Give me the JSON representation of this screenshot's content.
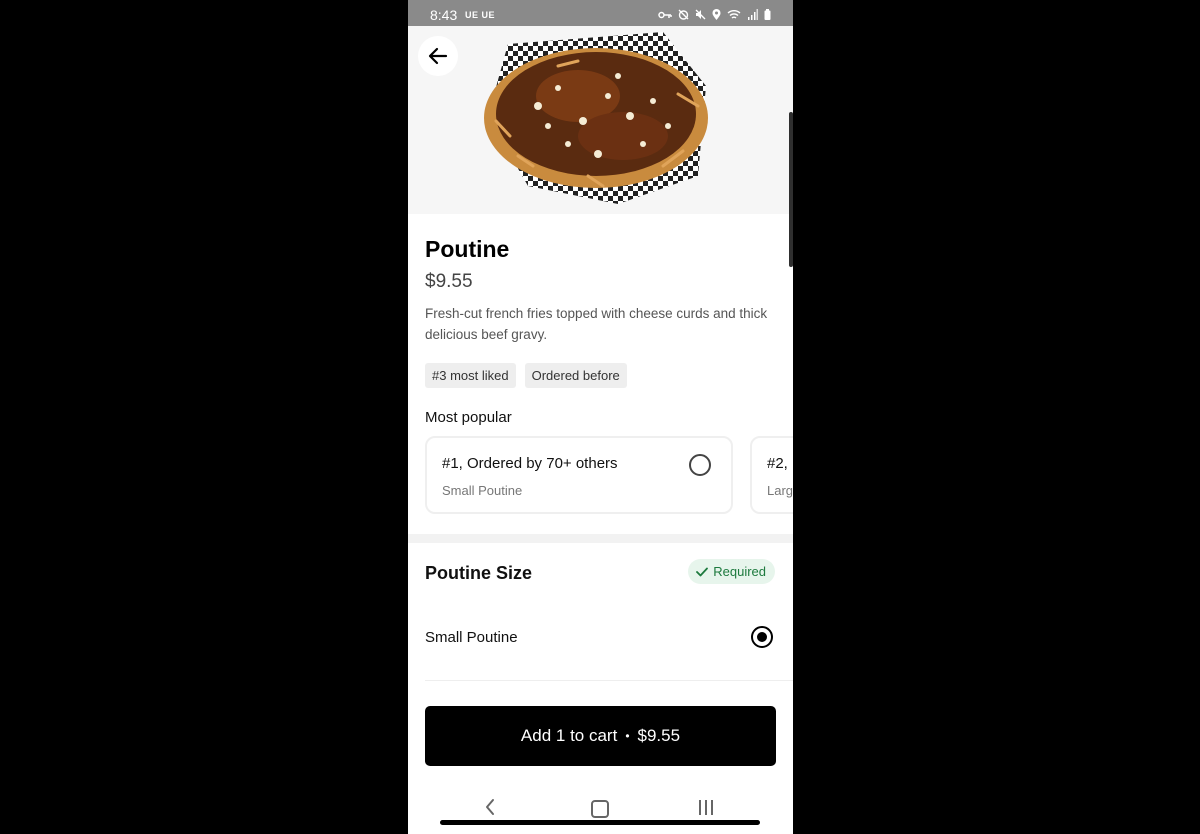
{
  "status_bar": {
    "time": "8:43",
    "carrier": "UE UE",
    "icons": [
      "key-icon",
      "alarm-icon",
      "mute-icon",
      "location-icon",
      "wifi-icon",
      "signal-icon",
      "battery-icon"
    ]
  },
  "item": {
    "title": "Poutine",
    "price": "$9.55",
    "description": "Fresh-cut french fries topped with cheese curds and thick delicious beef gravy.",
    "tags": [
      "#3 most liked",
      "Ordered before"
    ]
  },
  "most_popular": {
    "label": "Most popular",
    "cards": [
      {
        "title": "#1, Ordered by 70+ others",
        "subtitle": "Small Poutine"
      },
      {
        "title": "#2,",
        "subtitle": "Larg"
      }
    ]
  },
  "size_section": {
    "title": "Poutine Size",
    "badge": "Required",
    "options": [
      {
        "label": "Small Poutine",
        "selected": true
      }
    ]
  },
  "cart_button": {
    "label": "Add 1 to cart",
    "separator": "•",
    "price": "$9.55"
  },
  "colors": {
    "accent": "#000000",
    "required_bg": "#e7f5ec",
    "required_text": "#1d7a3e"
  }
}
